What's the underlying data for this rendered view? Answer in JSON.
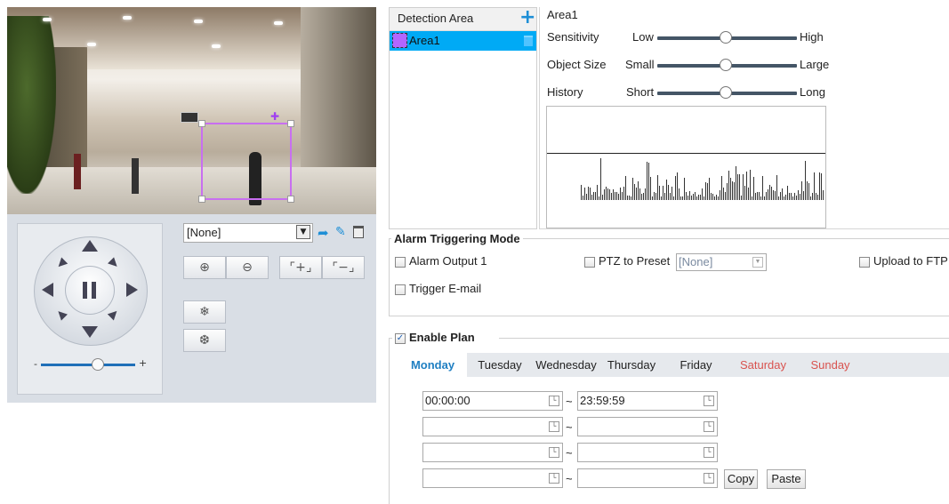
{
  "ptz": {
    "preset_selected": "[None]"
  },
  "detection": {
    "list_header": "Detection Area",
    "areas": [
      {
        "name": "Area1",
        "color": "#b266ff"
      }
    ],
    "selected_area": "Area1"
  },
  "params": {
    "sensitivity": {
      "label": "Sensitivity",
      "low": "Low",
      "high": "High",
      "value": 0.5
    },
    "object_size": {
      "label": "Object Size",
      "low": "Small",
      "high": "Large",
      "value": 0.5
    },
    "history": {
      "label": "History",
      "low": "Short",
      "high": "Long",
      "value": 0.5
    }
  },
  "alarm": {
    "title": "Alarm Triggering Mode",
    "alarm_output": "Alarm Output 1",
    "ptz_preset": "PTZ to Preset",
    "ptz_preset_value": "[None]",
    "upload_ftp": "Upload to FTP",
    "trigger_email": "Trigger E-mail"
  },
  "plan": {
    "title": "Enable Plan",
    "enabled": true,
    "days": [
      "Monday",
      "Tuesday",
      "Wednesday",
      "Thursday",
      "Friday",
      "Saturday",
      "Sunday"
    ],
    "active_day": "Monday",
    "rows": [
      {
        "start": "00:00:00",
        "end": "23:59:59"
      },
      {
        "start": "",
        "end": ""
      },
      {
        "start": "",
        "end": ""
      },
      {
        "start": "",
        "end": ""
      }
    ],
    "separator": "~",
    "copy_label": "Copy",
    "paste_label": "Paste"
  },
  "colors": {
    "accent": "#00aaf5",
    "weekend": "#d9534f",
    "active_tab": "#1f7fc2",
    "plus": "#1e8fd6"
  }
}
